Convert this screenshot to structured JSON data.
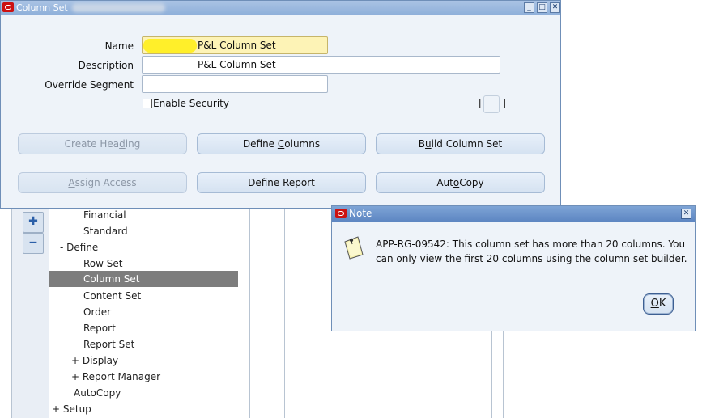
{
  "column_set_window": {
    "title": "Column Set",
    "controls": {
      "minimize": "_",
      "maximize": "□",
      "close": "✕"
    },
    "form": {
      "name_label": "Name",
      "name_value": "P&L Column Set",
      "description_label": "Description",
      "description_value": "P&L Column Set",
      "override_label": "Override Segment",
      "override_value": "",
      "enable_security_label": "Enable Security",
      "enable_security_checked": false,
      "bracket_open": "[",
      "bracket_close": "]"
    },
    "buttons": {
      "create_heading": {
        "before": "Create Hea",
        "mnemonic": "d",
        "after": "ing"
      },
      "define_columns": {
        "before": "Define ",
        "mnemonic": "C",
        "after": "olumns"
      },
      "build_column_set": {
        "before": "B",
        "mnemonic": "u",
        "after": "ild Column Set"
      },
      "assign_access": {
        "before": "",
        "mnemonic": "A",
        "after": "ssign Access"
      },
      "define_report": {
        "before": "Define Report",
        "mnemonic": "",
        "after": ""
      },
      "autocopy": {
        "before": "Aut",
        "mnemonic": "o",
        "after": "Copy"
      }
    }
  },
  "navigator": {
    "tools": {
      "expand": "✚",
      "collapse": "−"
    },
    "items": [
      {
        "label": "Financial"
      },
      {
        "label": "Standard"
      },
      {
        "label": "-  Define"
      },
      {
        "label": "Row Set"
      },
      {
        "label": "Column Set"
      },
      {
        "label": "Content Set"
      },
      {
        "label": "Order"
      },
      {
        "label": "Report"
      },
      {
        "label": "Report Set"
      },
      {
        "label": "+  Display"
      },
      {
        "label": "+  Report Manager"
      },
      {
        "label": "AutoCopy"
      },
      {
        "label": "+  Setup"
      }
    ]
  },
  "note_dialog": {
    "title": "Note",
    "close": "✕",
    "message": "APP-RG-09542: This column set has more than 20 columns.  You can only view the first 20 columns using the column set builder.",
    "ok": {
      "mnemonic": "O",
      "after": "K"
    }
  },
  "colors": {
    "window_bg": "#eef3f9",
    "titlebar": "#8fb0da",
    "required_field": "#fdf3b6",
    "selected_tree_item": "#7d7d7d",
    "oracle_red": "#cc1111"
  }
}
